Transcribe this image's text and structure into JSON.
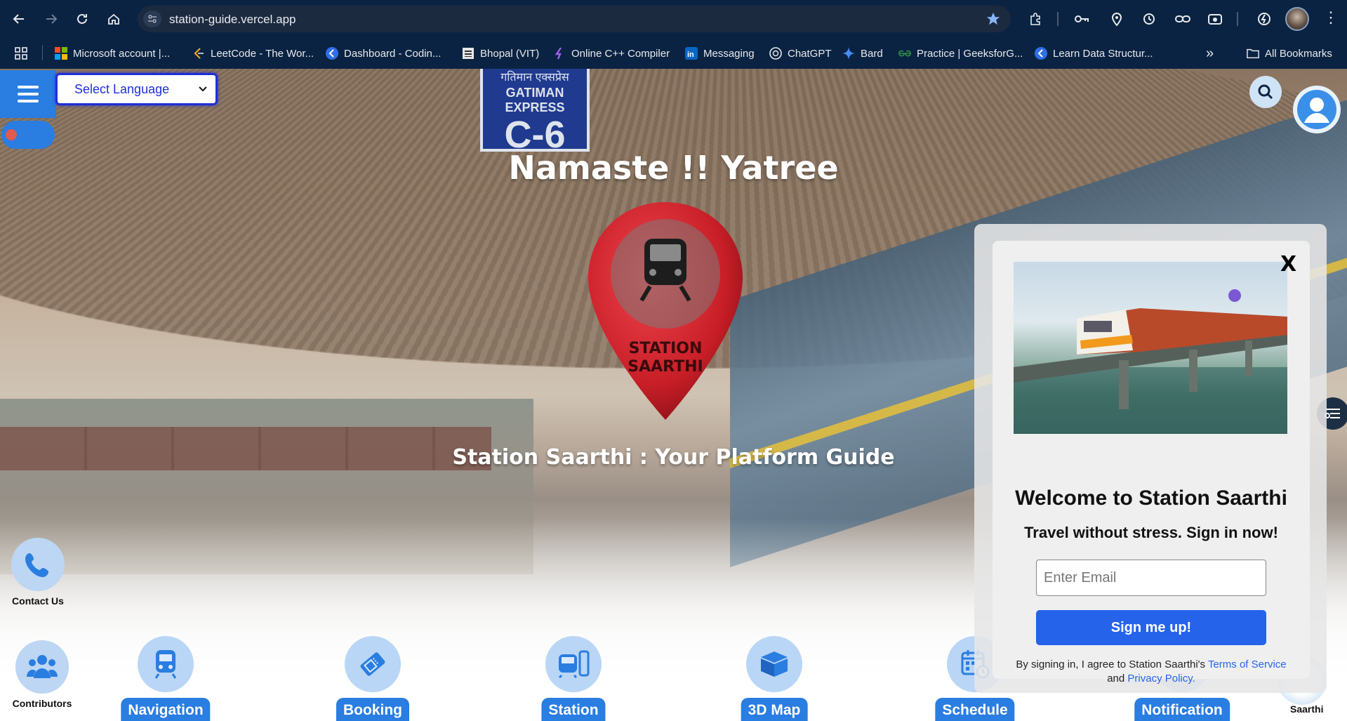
{
  "browser": {
    "url": "station-guide.vercel.app",
    "bookmarks": [
      {
        "label": "Microsoft account |...",
        "icon": "microsoft-icon"
      },
      {
        "label": "LeetCode - The Wor...",
        "icon": "leetcode-icon"
      },
      {
        "label": "Dashboard - Codin...",
        "icon": "codingninjas-icon"
      },
      {
        "label": "Bhopal (VIT)",
        "icon": "vit-icon"
      },
      {
        "label": "Online C++ Compiler",
        "icon": "compiler-icon"
      },
      {
        "label": "Messaging",
        "icon": "linkedin-icon"
      },
      {
        "label": "ChatGPT",
        "icon": "chatgpt-icon"
      },
      {
        "label": "Bard",
        "icon": "bard-icon"
      },
      {
        "label": "Practice | GeeksforG...",
        "icon": "geeksforgeeks-icon"
      },
      {
        "label": "Learn Data Structur...",
        "icon": "codingninjas-icon"
      }
    ],
    "all_bookmarks": "All Bookmarks"
  },
  "header": {
    "language_select": "Select Language"
  },
  "hero": {
    "sign_hindi": "गतिमान एक्सप्रेस",
    "sign_english": "GATIMAN EXPRESS",
    "sign_code": "C-6",
    "title": "Namaste !! Yatree",
    "logo_line1": "STATION",
    "logo_line2": "SAARTHI",
    "tagline": "Station Saarthi : Your Platform Guide"
  },
  "floating": {
    "contact": "Contact Us",
    "contributors": "Contributors",
    "saarthi": "Saarthi"
  },
  "features": [
    {
      "label": "Navigation",
      "icon": "train-icon"
    },
    {
      "label": "Booking",
      "icon": "ticket-icon"
    },
    {
      "label": "Station",
      "icon": "station-icon"
    },
    {
      "label": "3D Map",
      "icon": "box-icon"
    },
    {
      "label": "Schedule",
      "icon": "calendar-icon"
    },
    {
      "label": "Notification",
      "icon": "bell-icon"
    }
  ],
  "popup": {
    "close": "X",
    "title": "Welcome to Station Saarthi",
    "subtitle": "Travel without stress. Sign in now!",
    "email_placeholder": "Enter Email",
    "signup": "Sign me up!",
    "legal_prefix": "By signing in, I agree to Station Saarthi's ",
    "terms": "Terms of Service",
    "legal_and": "and ",
    "privacy": "Privacy Policy."
  },
  "colors": {
    "chrome_bg": "#0a2342",
    "accent": "#2a7de1",
    "signup": "#2563eb",
    "pin_red": "#d8262f"
  }
}
